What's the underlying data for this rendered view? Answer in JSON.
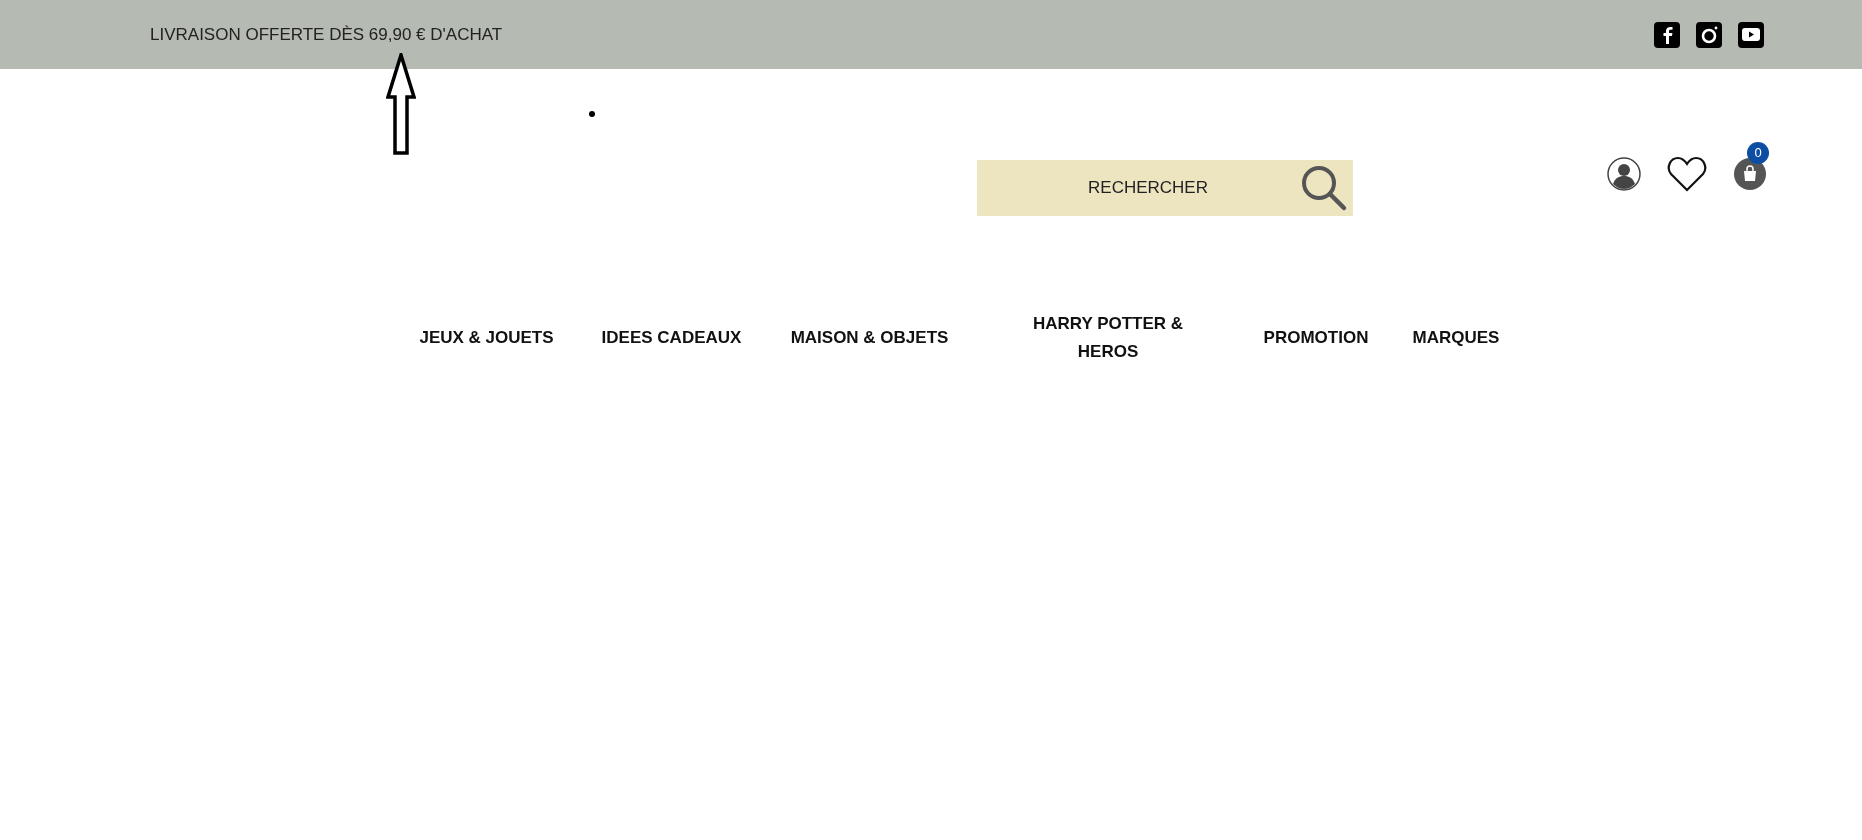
{
  "top_bar": {
    "message": "LIVRAISON OFFERTE DÈS 69,90 € D'ACHAT"
  },
  "search": {
    "placeholder": "RECHERCHER"
  },
  "cart": {
    "count": "0"
  },
  "nav": {
    "items": [
      {
        "label": "JEUX & JOUETS"
      },
      {
        "label": "IDEES CADEAUX"
      },
      {
        "label": "MAISON & OBJETS"
      },
      {
        "label": "HARRY POTTER & HEROS"
      },
      {
        "label": "PROMOTION"
      },
      {
        "label": "MARQUES"
      }
    ]
  }
}
